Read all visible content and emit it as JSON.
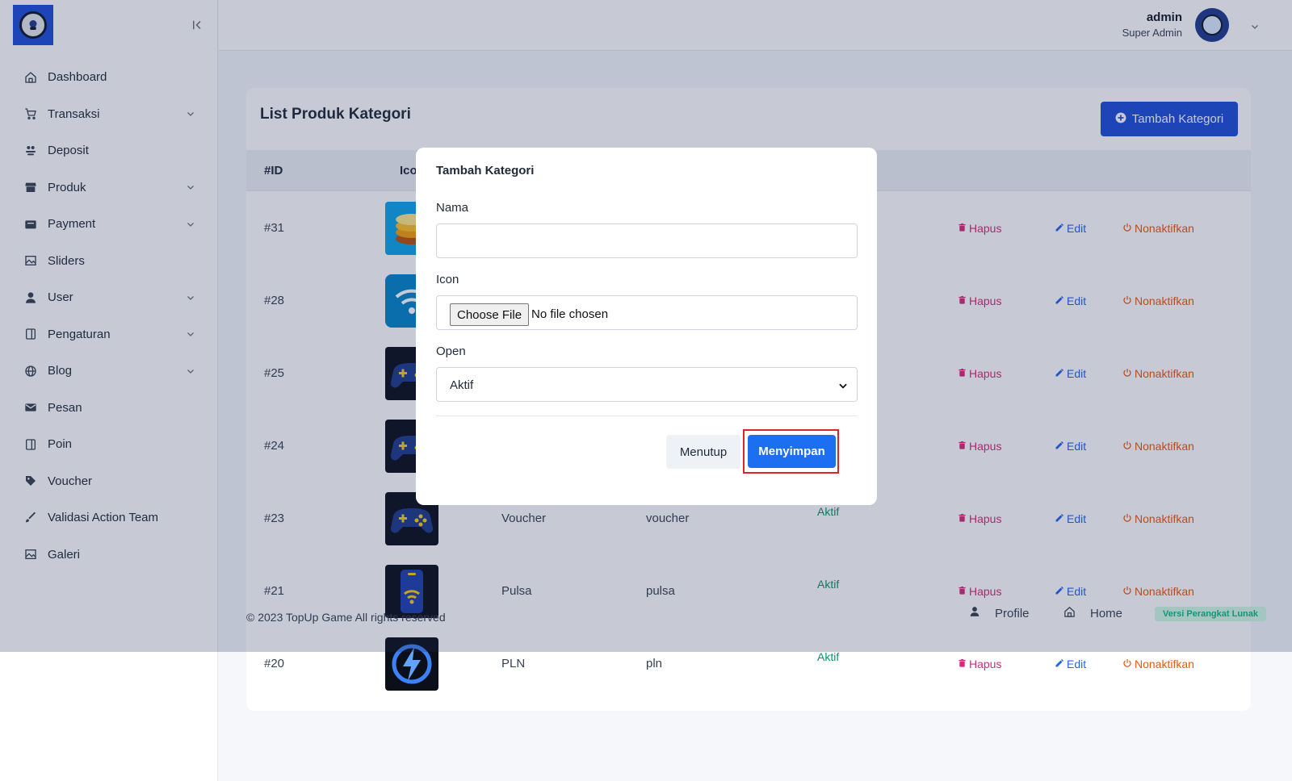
{
  "sidebar": {
    "items": [
      {
        "label": "Dashboard",
        "icon": "home-icon",
        "expandable": false
      },
      {
        "label": "Transaksi",
        "icon": "cart-icon",
        "expandable": true
      },
      {
        "label": "Deposit",
        "icon": "deposit-icon",
        "expandable": false
      },
      {
        "label": "Produk",
        "icon": "store-icon",
        "expandable": true
      },
      {
        "label": "Payment",
        "icon": "wallet-icon",
        "expandable": true
      },
      {
        "label": "Sliders",
        "icon": "image-icon",
        "expandable": false
      },
      {
        "label": "User",
        "icon": "user-icon",
        "expandable": true
      },
      {
        "label": "Pengaturan",
        "icon": "settings-panel-icon",
        "expandable": true
      },
      {
        "label": "Blog",
        "icon": "globe-icon",
        "expandable": true
      },
      {
        "label": "Pesan",
        "icon": "mail-icon",
        "expandable": false
      },
      {
        "label": "Poin",
        "icon": "points-icon",
        "expandable": false
      },
      {
        "label": "Voucher",
        "icon": "tag-icon",
        "expandable": false
      },
      {
        "label": "Validasi Action Team",
        "icon": "check-brush-icon",
        "expandable": false
      },
      {
        "label": "Galeri",
        "icon": "gallery-icon",
        "expandable": false
      }
    ]
  },
  "header": {
    "user_name": "admin",
    "user_role": "Super Admin"
  },
  "card": {
    "title": "List Produk Kategori",
    "add_button": "Tambah Kategori",
    "columns": {
      "id": "#ID",
      "icon": "Icon"
    },
    "rows": [
      {
        "id": "#31",
        "name": "",
        "slug": "",
        "status": "",
        "thumb": "coins",
        "bg": "#0ea5e9"
      },
      {
        "id": "#28",
        "name": "",
        "slug": "",
        "status": "",
        "thumb": "wifi",
        "bg": "#0284c7"
      },
      {
        "id": "#25",
        "name": "",
        "slug": "",
        "status": "",
        "thumb": "gamepad",
        "bg": "#0b0f1a"
      },
      {
        "id": "#24",
        "name": "",
        "slug": "",
        "status": "",
        "thumb": "gamepad",
        "bg": "#0b0f1a"
      },
      {
        "id": "#23",
        "name": "Voucher",
        "slug": "voucher",
        "status": "Aktif",
        "thumb": "gamepad",
        "bg": "#0b0f1a"
      },
      {
        "id": "#21",
        "name": "Pulsa",
        "slug": "pulsa",
        "status": "Aktif",
        "thumb": "phone",
        "bg": "#0b0f1a"
      },
      {
        "id": "#20",
        "name": "PLN",
        "slug": "pln",
        "status": "Aktif",
        "thumb": "bolt",
        "bg": "#0b0f1a"
      }
    ],
    "actions": {
      "delete": "Hapus",
      "edit": "Edit",
      "deactivate": "Nonaktifkan"
    }
  },
  "footer": {
    "copyright": "© 2023 TopUp Game All rights reserved",
    "profile": "Profile",
    "home": "Home",
    "version": "Versi Perangkat Lunak"
  },
  "modal": {
    "title": "Tambah Kategori",
    "name_label": "Nama",
    "name_value": "",
    "icon_label": "Icon",
    "file_button": "Choose File",
    "file_status": "No file chosen",
    "open_label": "Open",
    "open_value": "Aktif",
    "close_button": "Menutup",
    "save_button": "Menyimpan"
  },
  "colors": {
    "primary": "#1d4ed8",
    "status_active": "#059669",
    "delete": "#db2777",
    "edit": "#2563eb",
    "deactivate": "#ea580c",
    "highlight": "#dc2626"
  }
}
